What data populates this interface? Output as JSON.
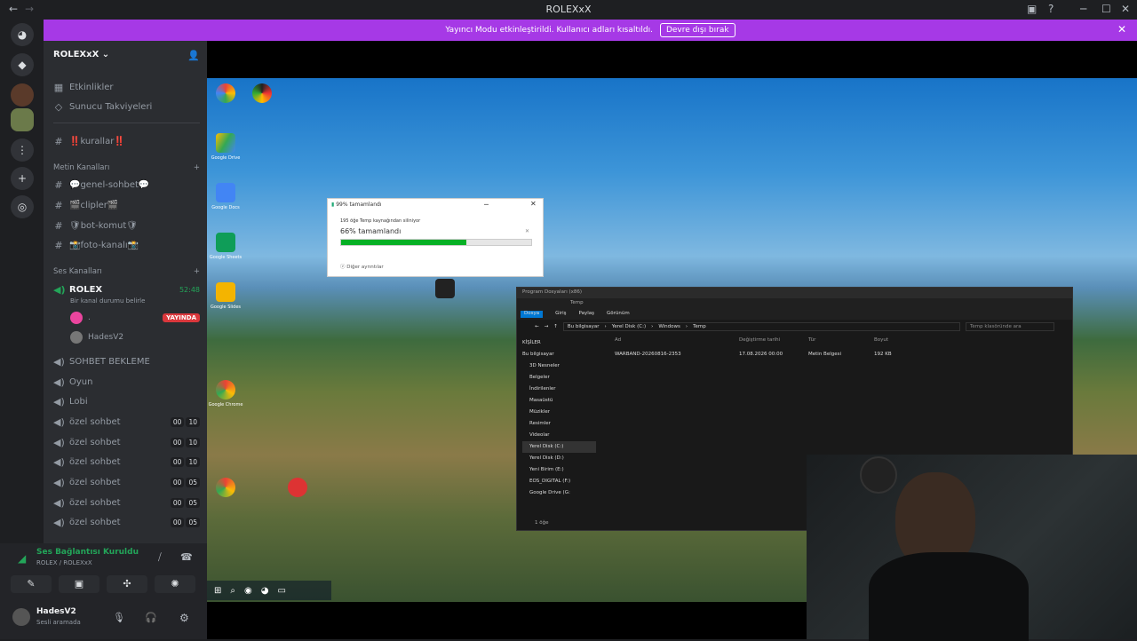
{
  "window": {
    "title": "ROLEXxX"
  },
  "banner": {
    "text": "Yayıncı Modu etkinleştirildi. Kullanıcı adları kısaltıldı.",
    "button": "Devre dışı bırak"
  },
  "server": {
    "name": "ROLEXxX"
  },
  "nav": {
    "events": "Etkinlikler",
    "boosts": "Sunucu Takviyeleri",
    "rules": "‼️kurallar‼️"
  },
  "text_category": "Metin Kanalları",
  "text_channels": [
    "💬genel-sohbet💬",
    "🎬clipler🎬",
    "🛡bot-komut🛡",
    "📸foto-kanalı📸"
  ],
  "voice_category": "Ses Kanalları",
  "active_voice": {
    "name": "ROLEX",
    "time": "52:48",
    "status": "Bir kanal durumu belirle",
    "live_badge": "YAYINDA",
    "user1": ".",
    "user2": "HadesV2"
  },
  "voice_channels": [
    {
      "name": "SOHBET BEKLEME"
    },
    {
      "name": "Oyun"
    },
    {
      "name": "Lobi"
    },
    {
      "name": "özel sohbet",
      "a": "00",
      "b": "10"
    },
    {
      "name": "özel sohbet",
      "a": "00",
      "b": "10"
    },
    {
      "name": "özel sohbet",
      "a": "00",
      "b": "10"
    },
    {
      "name": "özel sohbet",
      "a": "00",
      "b": "05"
    },
    {
      "name": "özel sohbet",
      "a": "00",
      "b": "05"
    },
    {
      "name": "özel sohbet",
      "a": "00",
      "b": "05"
    }
  ],
  "connection": {
    "title": "Ses Bağlantısı Kuruldu",
    "sub": "ROLEX / ROLEXxX"
  },
  "user": {
    "name": "HadesV2",
    "status": "Sesli aramada"
  },
  "desktop": {
    "icons": [
      "Google Drive",
      "Google Docs",
      "Google Sheets",
      "Google Slides",
      "Google Chrome"
    ],
    "copy_dialog": {
      "title": "99% tamamlandı",
      "line": "195 öğe Temp kaynağından siliniyor",
      "pct_text": "66% tamamlandı",
      "progress": 0.66,
      "more": "Diğer ayrıntılar"
    },
    "explorer": {
      "title": "Program Dosyaları (x86)",
      "title2": "Temp",
      "tabs": [
        "Dosya",
        "Giriş",
        "Paylaş",
        "Görünüm"
      ],
      "crumbs": [
        "Bu bilgisayar",
        "Yerel Disk (C:)",
        "Windows",
        "Temp"
      ],
      "search": "Temp klasöründe ara",
      "cols": [
        "Ad",
        "Değiştirme tarihi",
        "Tür",
        "Boyut"
      ],
      "file": {
        "name": "WARBAND-20260816-2353",
        "date": "17.08.2026 00:00",
        "type": "Metin Belgesi",
        "size": "192 KB"
      },
      "sidebar": [
        "KİŞİLER",
        "Bu bilgisayar",
        "3D Nesneler",
        "Belgeler",
        "İndirilenler",
        "Masaüstü",
        "Müzikler",
        "Resimler",
        "Videolar",
        "Yerel Disk (C:)",
        "Yerel Disk (D:)",
        "Yeni Birim (E:)",
        "EOS_DIGITAL (F:)",
        "Google Drive (G:"
      ],
      "status": "1 öğe"
    }
  },
  "colors": {
    "accent": "#a639e6",
    "green": "#23a559",
    "live": "#da373c"
  }
}
